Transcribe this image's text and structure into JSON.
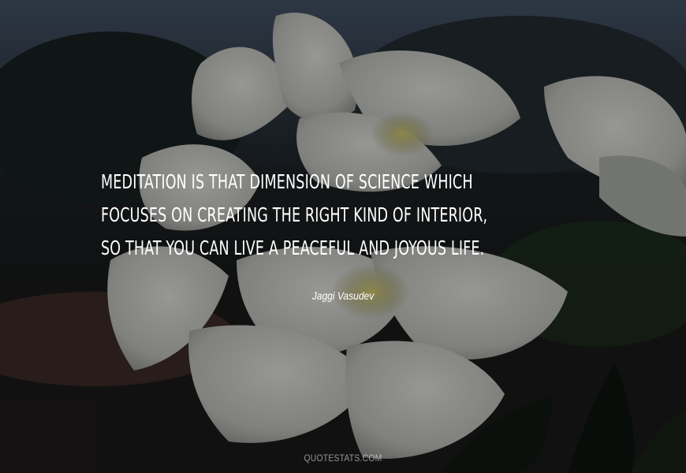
{
  "quote": {
    "lines": [
      "MEDITATION IS THAT DIMENSION OF SCIENCE WHICH",
      "FOCUSES ON CREATING THE RIGHT KIND OF INTERIOR,",
      "SO THAT YOU CAN LIVE A PEACEFUL AND JOYOUS LIFE."
    ]
  },
  "author": "Jaggi Vasudev",
  "watermark": "QUOTESTATS.COM",
  "colors": {
    "text": "#ffffff",
    "petal": "#d9dbd6",
    "flower_center": "#c9c16a",
    "background_dark": "#1a1c1d"
  }
}
